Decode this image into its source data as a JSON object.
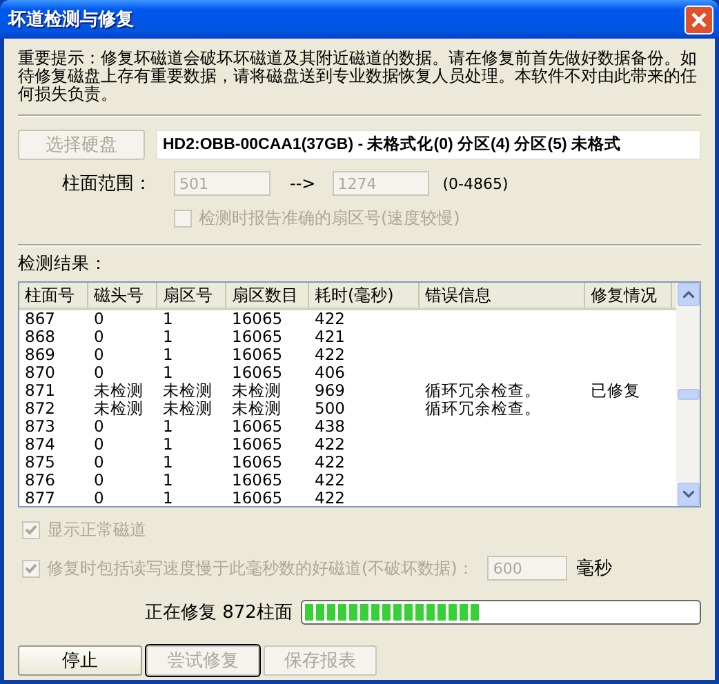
{
  "window": {
    "title": "坏道检测与修复"
  },
  "notice": "重要提示：修复坏磁道会破坏坏磁道及其附近磁道的数据。请在修复前首先做好数据备份。如待修复磁盘上存有重要数据，请将磁盘送到专业数据恢复人员处理。本软件不对由此带来的任何损失负责。",
  "disk": {
    "select_button": {
      "label": "选择硬盘",
      "disabled": true
    },
    "info": "HD2:OBB-00CAA1(37GB) - 未格式化(0) 分区(4) 分区(5) 未格式"
  },
  "range": {
    "label": "柱面范围：",
    "from": "501",
    "arrow": "-->",
    "to": "1274",
    "hint": "(0-4865)",
    "disabled": true
  },
  "report_exact_sector": {
    "label": "检测时报告准确的扇区号(速度较慢)",
    "checked": false,
    "disabled": true
  },
  "results": {
    "label": "检测结果：",
    "columns": [
      "柱面号",
      "磁头号",
      "扇区号",
      "扇区数目",
      "耗时(毫秒)",
      "错误信息",
      "修复情况"
    ],
    "rows": [
      [
        "867",
        "0",
        "1",
        "16065",
        "422",
        "",
        ""
      ],
      [
        "868",
        "0",
        "1",
        "16065",
        "421",
        "",
        ""
      ],
      [
        "869",
        "0",
        "1",
        "16065",
        "422",
        "",
        ""
      ],
      [
        "870",
        "0",
        "1",
        "16065",
        "406",
        "",
        ""
      ],
      [
        "871",
        "未检测",
        "未检测",
        "未检测",
        "969",
        "循环冗余检查。",
        "已修复"
      ],
      [
        "872",
        "未检测",
        "未检测",
        "未检测",
        "500",
        "循环冗余检查。",
        ""
      ],
      [
        "873",
        "0",
        "1",
        "16065",
        "438",
        "",
        ""
      ],
      [
        "874",
        "0",
        "1",
        "16065",
        "422",
        "",
        ""
      ],
      [
        "875",
        "0",
        "1",
        "16065",
        "422",
        "",
        ""
      ],
      [
        "876",
        "0",
        "1",
        "16065",
        "422",
        "",
        ""
      ],
      [
        "877",
        "0",
        "1",
        "16065",
        "422",
        "",
        ""
      ]
    ]
  },
  "show_normal": {
    "label": "显示正常磁道",
    "checked": true,
    "disabled": true
  },
  "include_slow": {
    "label": "修复时包括读写速度慢于此毫秒数的好磁道(不破坏数据)：",
    "checked": true,
    "disabled": true,
    "value": "600",
    "unit": "毫秒"
  },
  "progress": {
    "label": "正在修复 872柱面",
    "level": 0.45
  },
  "buttons": [
    {
      "label": "停止",
      "disabled": false,
      "focused": false
    },
    {
      "label": "尝试修复",
      "disabled": true,
      "focused": true
    },
    {
      "label": "保存报表",
      "disabled": true,
      "focused": false
    }
  ]
}
